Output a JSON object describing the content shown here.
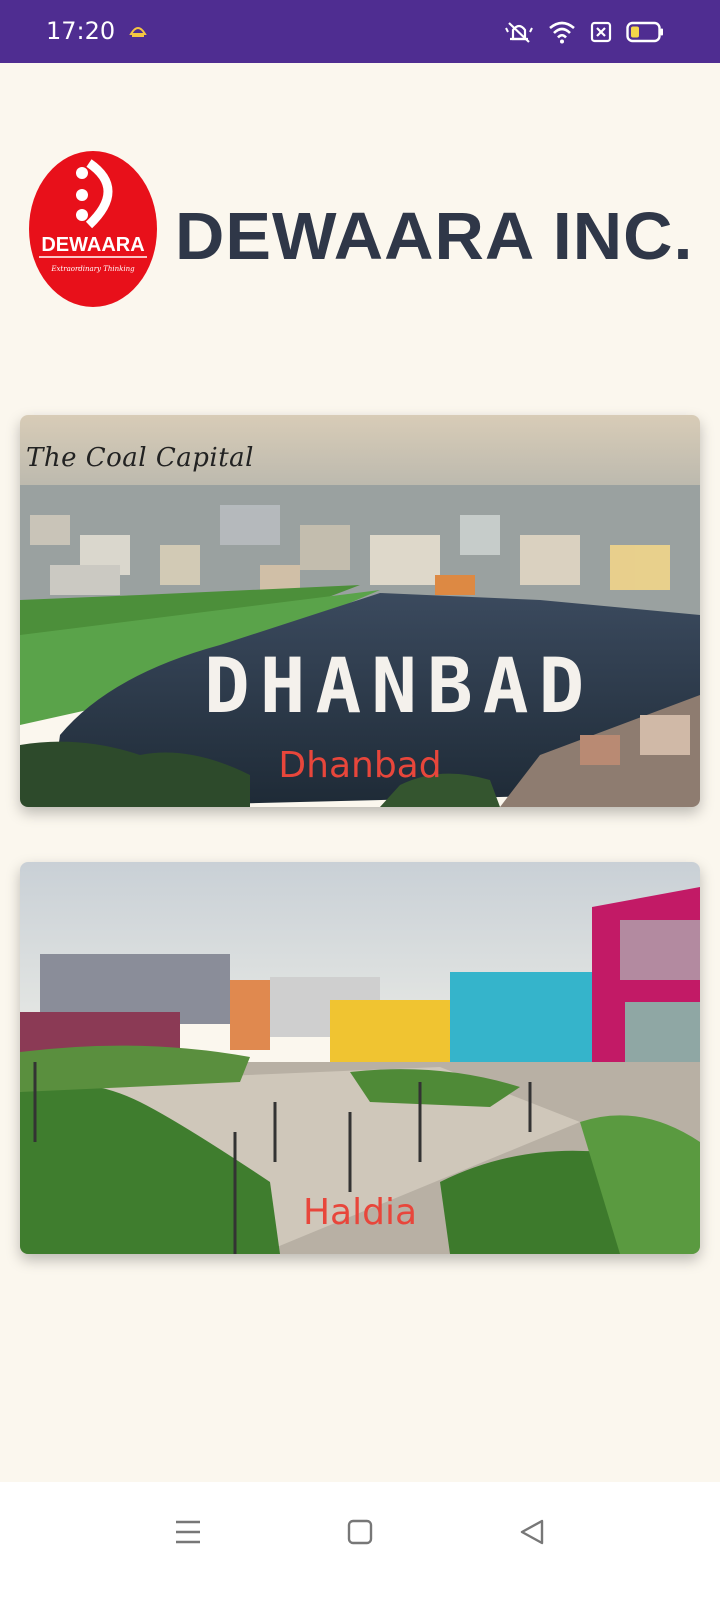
{
  "status_bar": {
    "time": "17:20",
    "icons": [
      "notification-icon",
      "mute-icon",
      "wifi-icon",
      "sim-off-icon",
      "battery-icon"
    ],
    "bg_color": "#4f2d91"
  },
  "header": {
    "logo_text": "DEWAARA",
    "logo_tagline": "Extraordinary Thinking",
    "title": "DEWAARA INC.",
    "logo_color": "#e8101a",
    "title_color": "#2f3748"
  },
  "cities": [
    {
      "name": "Dhanbad",
      "image_tagline": "The Coal Capital",
      "image_title": "DHANBAD"
    },
    {
      "name": "Haldia"
    }
  ],
  "nav_bar": {
    "buttons": [
      "menu-icon",
      "home-icon",
      "back-icon"
    ]
  },
  "colors": {
    "background": "#fbf7ee",
    "city_label": "#e8463b"
  }
}
